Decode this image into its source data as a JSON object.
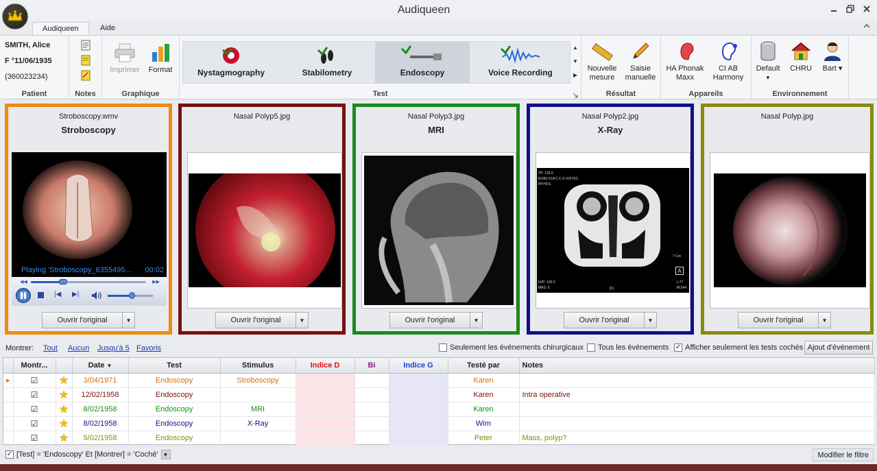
{
  "window": {
    "title": "Audiqueen"
  },
  "ribbon_tabs": [
    {
      "label": "Audiqueen"
    },
    {
      "label": "Aide"
    }
  ],
  "patient": {
    "name": "SMITH, Alice",
    "sex_dob": "F °11/06/1935",
    "id": "(360023234)",
    "group_label": "Patient"
  },
  "notes": {
    "group_label": "Notes"
  },
  "graphique": {
    "group_label": "Graphique",
    "print_label": "Imprimer",
    "format_label": "Format"
  },
  "test": {
    "group_label": "Test",
    "items": [
      {
        "label": "Nystagmography"
      },
      {
        "label": "Stabilometry"
      },
      {
        "label": "Endoscopy"
      },
      {
        "label": "Voice Recording"
      }
    ]
  },
  "resultat": {
    "group_label": "Résultat",
    "new_label_1": "Nouvelle",
    "new_label_2": "mesure",
    "manual_label_1": "Saisie",
    "manual_label_2": "manuelle"
  },
  "appareils": {
    "group_label": "Appareils",
    "ha_label_1": "HA Phonak",
    "ha_label_2": "Maxx",
    "ci_label_1": "CI AB",
    "ci_label_2": "Harmony"
  },
  "environnement": {
    "group_label": "Environnement",
    "default_label": "Default",
    "chru_label": "CHRU",
    "user_label": "Bart"
  },
  "cards": [
    {
      "file": "Stroboscopy.wmv",
      "title": "Stroboscopy",
      "border": "#f08a10",
      "open_label": "Ouvrir l'original"
    },
    {
      "file": "Nasal Polyp5.jpg",
      "title": "",
      "border": "#7a1010",
      "open_label": "Ouvrir l'original"
    },
    {
      "file": "Nasal Polyp3.jpg",
      "title": "MRI",
      "border": "#1a8a1a",
      "open_label": "Ouvrir l'original"
    },
    {
      "file": "Nasal Polyp2.jpg",
      "title": "X-Ray",
      "border": "#10108a",
      "open_label": "Ouvrir l'original"
    },
    {
      "file": "Nasal Polyp.jpg",
      "title": "",
      "border": "#8a8a10",
      "open_label": "Ouvrir l'original"
    }
  ],
  "player": {
    "status": "Playing 'Stroboscopy_6355495...",
    "time": "00:02",
    "progress": 0.28,
    "volume": 0.55
  },
  "xray": {
    "top_left_1": "TP: 125.0",
    "top_left_2": "EDAD 51A C:C E:VOITEC",
    "top_left_3": "PP:HFS",
    "scale": "7 Cm",
    "marker": "A",
    "bottom_left_1": "kVP: 120.0",
    "bottom_left_2": "MAS: 0",
    "bottom_mid": "[F]",
    "bottom_right_1": "L:77",
    "bottom_right_2": "W:344"
  },
  "filter": {
    "show_label": "Montrer:",
    "links": [
      {
        "label": "Tout"
      },
      {
        "label": "Aucun"
      },
      {
        "label": "Jusqu'à 5"
      },
      {
        "label": "Favoris"
      }
    ],
    "chk_surgical": "Seulement les événements chirurgicaux",
    "chk_all": "Tous les événements",
    "chk_checked": "Afficher seulement les tests cochés",
    "add_event": "Ajout d'événement"
  },
  "grid": {
    "headers": {
      "show": "Montr...",
      "date": "Date",
      "test": "Test",
      "stimulus": "Stimulus",
      "ind_d": "Indice D",
      "bi": "Bi",
      "ind_g": "Indice G",
      "tested_by": "Testé par",
      "notes": "Notes"
    },
    "rows": [
      {
        "date": "3/04/1971",
        "test": "Endoscopy",
        "stimulus": "Stroboscopy",
        "by": "Karen",
        "notes": "",
        "color": "#d07010"
      },
      {
        "date": "12/02/1958",
        "test": "Endoscopy",
        "stimulus": "",
        "by": "Karen",
        "notes": "Intra operative",
        "color": "#7a1010"
      },
      {
        "date": "8/02/1958",
        "test": "Endoscopy",
        "stimulus": "MRI",
        "by": "Karen",
        "notes": "",
        "color": "#1a8a1a"
      },
      {
        "date": "8/02/1958",
        "test": "Endoscopy",
        "stimulus": "X-Ray",
        "by": "Wim",
        "notes": "",
        "color": "#10108a"
      },
      {
        "date": "5/02/1958",
        "test": "Endoscopy",
        "stimulus": "",
        "by": "Peter",
        "notes": "Mass, polyp?",
        "color": "#8a8a10"
      }
    ]
  },
  "status": {
    "filter_text": "[Test] = 'Endoscopy' Et [Montrer] = 'Coché'",
    "modify_label": "Modifier le filtre"
  }
}
